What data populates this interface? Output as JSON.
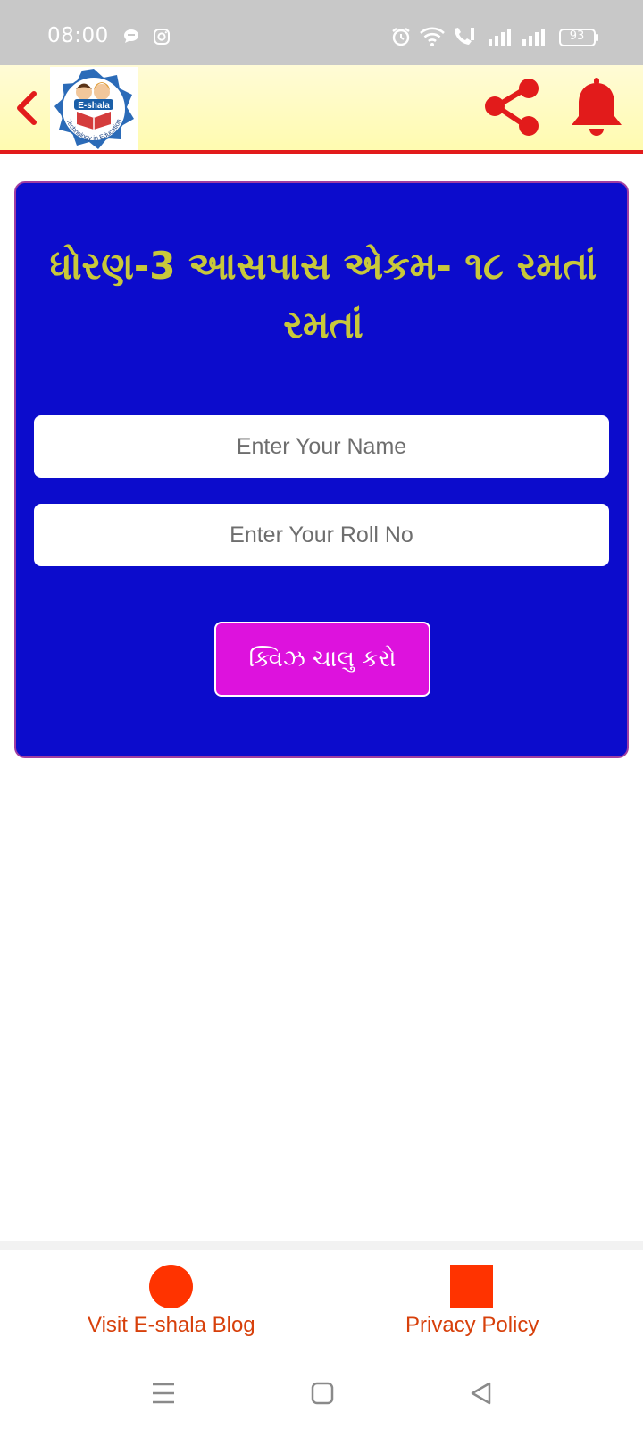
{
  "status_bar": {
    "time": "08:00",
    "battery": "93",
    "icons": [
      "chat-bubble-icon",
      "instagram-icon",
      "alarm-icon",
      "wifi-icon",
      "volte-call-icon",
      "signal-icon",
      "signal-icon",
      "battery-icon"
    ]
  },
  "app_bar": {
    "logo_text": "E-shala",
    "logo_tagline": "Technology in Education",
    "icons": [
      "back-arrow-icon",
      "share-icon",
      "bell-icon"
    ]
  },
  "quiz": {
    "title": "ધોરણ-3 આસપાસ એકમ- ૧૮ રમતાં રમતાં",
    "name_placeholder": "Enter Your Name",
    "roll_placeholder": "Enter Your Roll No",
    "start_label": "ક્વિઝ ચાલુ કરો"
  },
  "bottom_links": {
    "blog_label": "Visit E-shala Blog",
    "privacy_label": "Privacy Policy"
  },
  "colors": {
    "status_bar_bg": "#c8c8c8",
    "app_bar_bg": "#fffbb0",
    "accent_red": "#e21b1b",
    "card_bg": "#0c0ccc",
    "title_color": "#c8c83a",
    "start_button_bg": "#dd12dd",
    "link_color": "#d7400b",
    "link_icon_color": "#ff3300"
  }
}
